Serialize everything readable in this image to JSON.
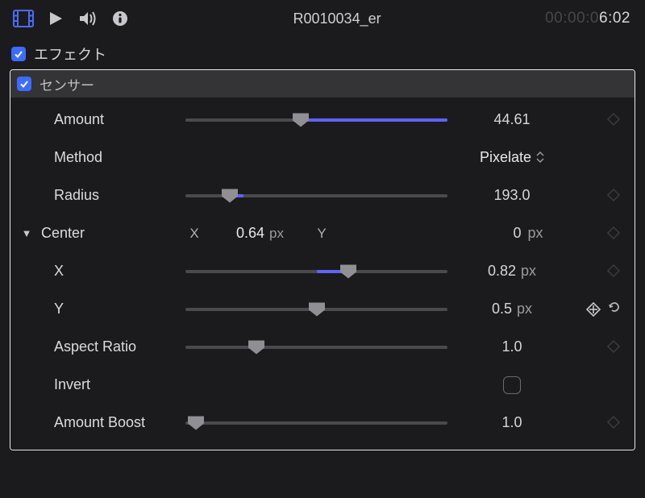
{
  "header": {
    "title": "R0010034_er",
    "timecode_dim": "00:00:0",
    "timecode_lit": "6:02"
  },
  "section": {
    "effects_label": "エフェクト"
  },
  "effect": {
    "name": "センサー"
  },
  "params": {
    "amount": {
      "label": "Amount",
      "value": "44.61",
      "slider_pos": 0.44
    },
    "method": {
      "label": "Method",
      "value": "Pixelate"
    },
    "radius": {
      "label": "Radius",
      "value": "193.0",
      "slider_pos": 0.17
    },
    "center": {
      "label": "Center",
      "x_label": "X",
      "x_value": "0.64",
      "x_unit": "px",
      "y_label": "Y",
      "y_value": "0",
      "y_unit": "px"
    },
    "x": {
      "label": "X",
      "value": "0.82",
      "unit": "px",
      "slider_pos": 0.62,
      "fill_start": 0.5
    },
    "y": {
      "label": "Y",
      "value": "0.5",
      "unit": "px",
      "slider_pos": 0.5
    },
    "aspect": {
      "label": "Aspect Ratio",
      "value": "1.0",
      "slider_pos": 0.27
    },
    "invert": {
      "label": "Invert"
    },
    "amount_boost": {
      "label": "Amount Boost",
      "value": "1.0",
      "slider_pos": 0.02
    }
  }
}
